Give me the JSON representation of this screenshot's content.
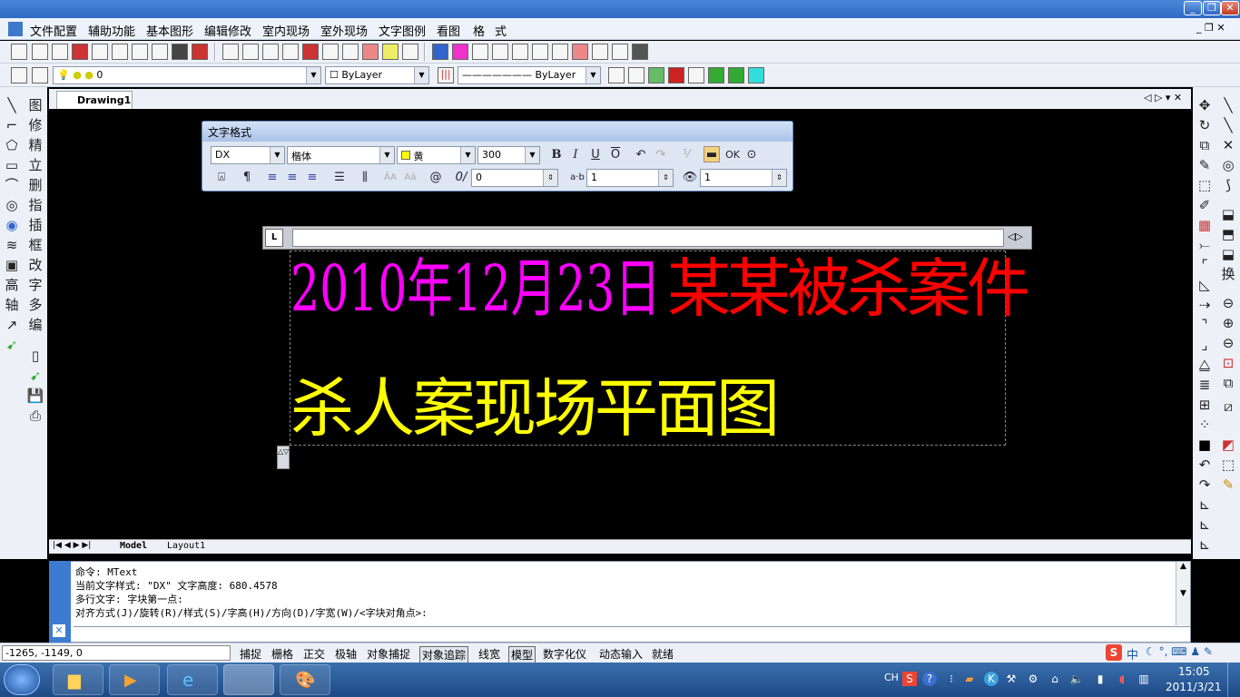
{
  "menu": [
    "文件配置",
    "辅助功能",
    "基本图形",
    "编辑修改",
    "室内现场",
    "室外现场",
    "文字图例",
    "看图",
    "格",
    "式"
  ],
  "layer": {
    "value": "0"
  },
  "color_combo": {
    "value": "ByLayer"
  },
  "linetype_combo": {
    "value": "ByLayer"
  },
  "drawing_tab": {
    "label": "Drawing1"
  },
  "left_tools_b": [
    "图",
    "修",
    "精",
    "立",
    "删",
    "指",
    "插",
    "框",
    "改",
    "字",
    "多",
    "编"
  ],
  "left_tools_a_extra": [
    "高",
    "轴"
  ],
  "text_format": {
    "title": "文字格式",
    "style": "DX",
    "font": "楷体",
    "color": "黄",
    "height": "300",
    "bold": "B",
    "italic": "I",
    "underline": "U",
    "overline": "O",
    "ok": "OK",
    "oblique": "0",
    "tracking": "1",
    "width": "1"
  },
  "ruler": {
    "label": "L"
  },
  "content": {
    "line1_date": "2010年12月23日",
    "line1_title": "某某被杀案件",
    "line2": "杀人案现场平面图"
  },
  "layout_tabs": [
    "Model",
    "Layout1"
  ],
  "command": {
    "lines": [
      "命令: MText",
      "当前文字样式: \"DX\" 文字高度: 680.4578",
      "多行文字: 字块第一点:",
      "对齐方式(J)/旋转(R)/样式(S)/字高(H)/方向(D)/字宽(W)/<字块对角点>:"
    ]
  },
  "status": {
    "coords": "-1265, -1149, 0",
    "buttons": [
      "捕捉",
      "栅格",
      "正交",
      "极轴",
      "对象捕捉",
      "对象追踪",
      "线宽",
      "模型",
      "数字化仪",
      "动态输入",
      "就绪"
    ]
  },
  "tray": {
    "lang": "CH",
    "ime": "中",
    "time": "15:05",
    "date": "2011/3/21"
  },
  "colors": {
    "magenta": "#ff00ff",
    "red": "#ff0000",
    "yellow": "#ffff00"
  }
}
